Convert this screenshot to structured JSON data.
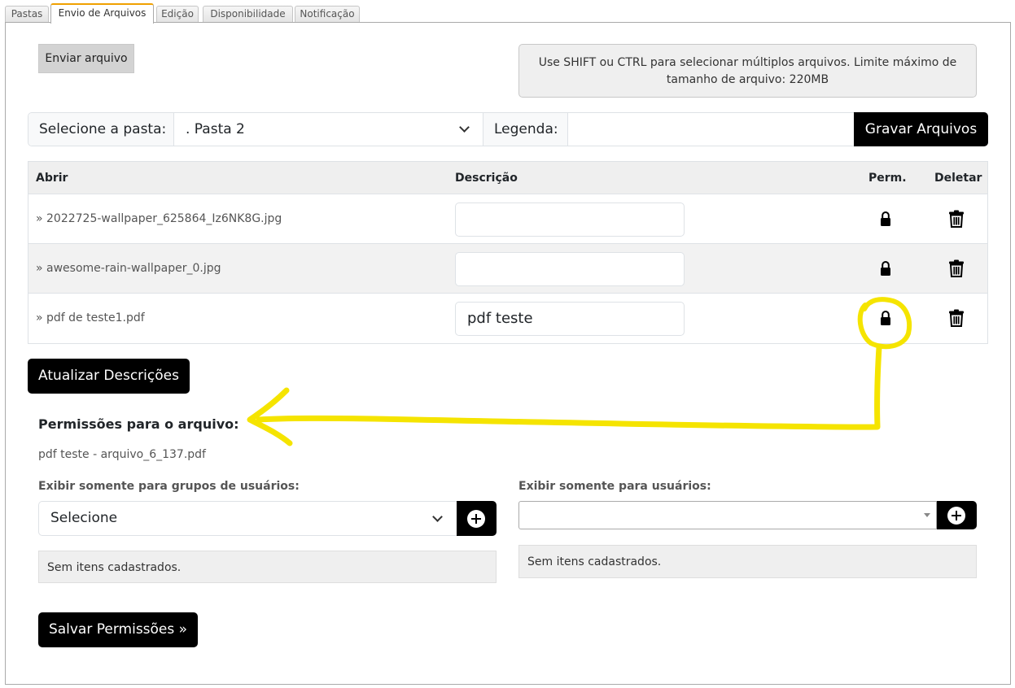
{
  "tabs": [
    {
      "label": "Pastas",
      "active": false
    },
    {
      "label": "Envio de Arquivos",
      "active": true
    },
    {
      "label": "Edição",
      "active": false
    },
    {
      "label": "Disponibilidade",
      "active": false
    },
    {
      "label": "Notificação",
      "active": false
    }
  ],
  "upload": {
    "send_button": "Enviar arquivo",
    "info_line1": "Use SHIFT ou CTRL para selecionar múltiplos arquivos. Limite máximo de",
    "info_line2": "tamanho de arquivo: 220MB"
  },
  "folder_bar": {
    "folder_label": "Selecione a pasta:",
    "folder_value": ". Pasta 2",
    "caption_label": "Legenda:",
    "caption_value": "",
    "save_button": "Gravar Arquivos"
  },
  "table": {
    "headers": {
      "open": "Abrir",
      "description": "Descrição",
      "perm": "Perm.",
      "delete": "Deletar"
    },
    "rows": [
      {
        "file": "» 2022725-wallpaper_625864_Iz6NK8G.jpg",
        "description": ""
      },
      {
        "file": "» awesome-rain-wallpaper_0.jpg",
        "description": ""
      },
      {
        "file": "» pdf de teste1.pdf",
        "description": "pdf teste"
      }
    ]
  },
  "update_button": "Atualizar Descrições",
  "permissions": {
    "title": "Permissões para o arquivo:",
    "file_info": "pdf teste - arquivo_6_137.pdf",
    "groups_label": "Exibir somente para grupos de usuários:",
    "groups_select": "Selecione",
    "groups_empty": "Sem itens cadastrados.",
    "users_label": "Exibir somente para usuários:",
    "users_select": "",
    "users_empty": "Sem itens cadastrados.",
    "save_button": "Salvar Permissões »"
  },
  "icons": {
    "lock": "lock-icon",
    "trash": "trash-icon",
    "plus": "plus-circle-icon",
    "chevron": "chevron-down-icon"
  },
  "colors": {
    "highlight": "#f5e400",
    "button": "#000000",
    "tab_accent": "#f0a000"
  }
}
